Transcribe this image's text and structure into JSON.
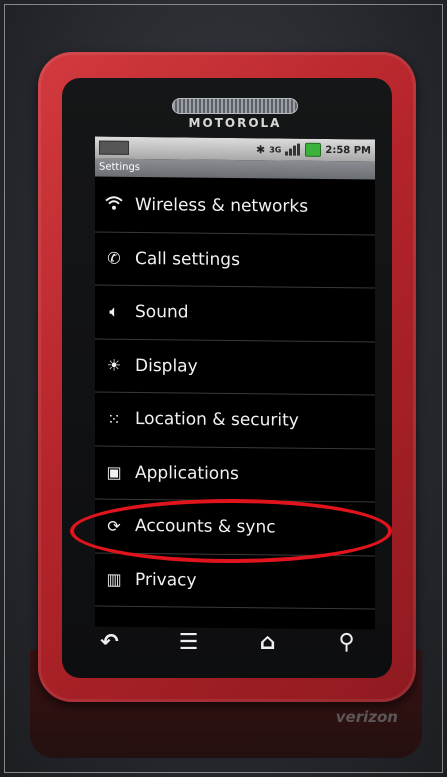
{
  "device": {
    "brand": "MOTOROLA",
    "carrier": "verizon",
    "case_color": "#b3242a"
  },
  "status_bar": {
    "network": "3G",
    "time": "2:58 PM"
  },
  "screen_title": "Settings",
  "menu": [
    {
      "label": "Wireless & networks",
      "icon": "wifi-icon"
    },
    {
      "label": "Call settings",
      "icon": "phone-icon"
    },
    {
      "label": "Sound",
      "icon": "speaker-icon"
    },
    {
      "label": "Display",
      "icon": "brightness-icon"
    },
    {
      "label": "Location & security",
      "icon": "grid-lock-icon"
    },
    {
      "label": "Applications",
      "icon": "applications-icon"
    },
    {
      "label": "Accounts & sync",
      "icon": "sync-icon"
    },
    {
      "label": "Privacy",
      "icon": "privacy-icon"
    }
  ],
  "nav_buttons": [
    {
      "icon": "back-icon"
    },
    {
      "icon": "menu-icon"
    },
    {
      "icon": "home-icon"
    },
    {
      "icon": "search-icon"
    }
  ],
  "annotation": {
    "highlighted_item": "Accounts & sync",
    "color": "#e0141c"
  }
}
